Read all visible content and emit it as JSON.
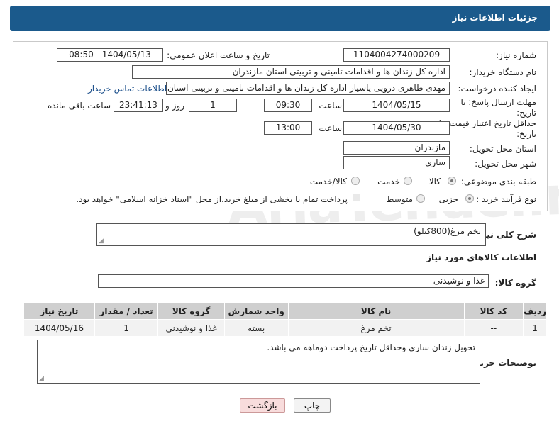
{
  "header": {
    "title": "جزئیات اطلاعات نیاز"
  },
  "form": {
    "need_number_label": "شماره نیاز:",
    "need_number": "1104004274000209",
    "announce_label": "تاریخ و ساعت اعلان عمومی:",
    "announce_value": "1404/05/13 - 08:50",
    "buyer_org_label": "نام دستگاه خریدار:",
    "buyer_org": "اداره کل زندان ها و اقدامات تامینی و تربیتی استان مازندران",
    "creator_label": "ایجاد کننده درخواست:",
    "creator": "مهدی طاهری دروپی پاسیار اداره کل زندان ها و اقدامات تامینی و تربیتی استان",
    "contact_link": "اطلاعات تماس خریدار",
    "reply_deadline_label": "مهلت ارسال پاسخ: تا تاریخ:",
    "reply_date": "1404/05/15",
    "time_label": "ساعت",
    "reply_time": "09:30",
    "days_value": "1",
    "days_label": "روز و",
    "remaining_time": "23:41:13",
    "remaining_label": "ساعت باقی مانده",
    "price_deadline_label": "حداقل تاریخ اعتبار قیمت: تا تاریخ:",
    "price_date": "1404/05/30",
    "price_time": "13:00",
    "province_label": "استان محل تحویل:",
    "province": "مازندران",
    "city_label": "شهر محل تحویل:",
    "city": "ساری",
    "category_label": "طبقه بندی موضوعی:",
    "category_options": [
      "کالا",
      "خدمت",
      "کالا/خدمت"
    ],
    "purchase_type_label": "نوع فرآیند خرید :",
    "purchase_options": [
      "جزیی",
      "متوسط"
    ],
    "payment_note": "پرداخت تمام یا بخشی از مبلغ خرید،از محل \"اسناد خزانه اسلامی\" خواهد بود."
  },
  "description": {
    "label": "شرح کلی نیاز:",
    "value": "تخم مرغ(800کیلو)"
  },
  "goods": {
    "section_title": "اطلاعات کالاهای مورد نیاز",
    "group_label": "گروه کالا:",
    "group_value": "غذا و نوشیدنی",
    "columns": [
      "ردیف",
      "کد کالا",
      "نام کالا",
      "واحد شمارش",
      "گروه کالا",
      "تعداد / مقدار",
      "تاریخ نیاز"
    ],
    "rows": [
      [
        "1",
        "--",
        "تخم مرغ",
        "بسته",
        "غذا و نوشیدنی",
        "1",
        "1404/05/16"
      ]
    ]
  },
  "buyer_notes": {
    "label": "توضیحات خریدار:",
    "value": "تحویل زندان ساری وحداقل تاریخ پرداخت دوماهه می باشد."
  },
  "buttons": {
    "print": "چاپ",
    "back": "بازگشت"
  },
  "watermark": "AriaTender.neT"
}
